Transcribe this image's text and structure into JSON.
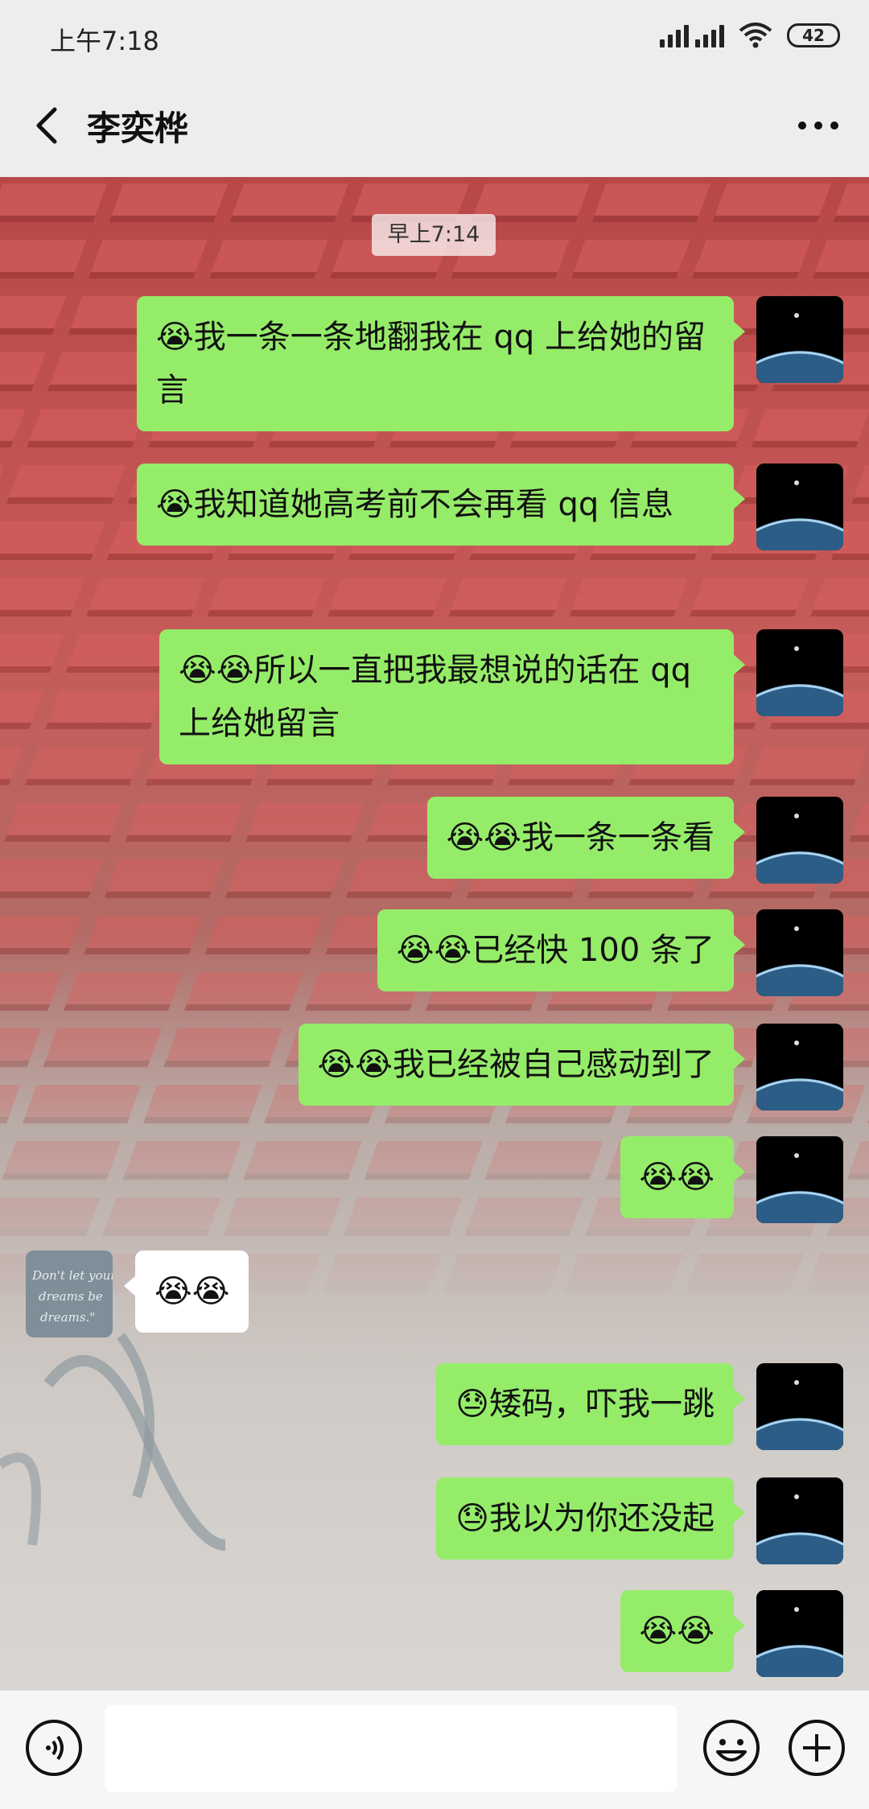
{
  "status_bar": {
    "time": "上午7:18",
    "battery": "42"
  },
  "header": {
    "contact_name": "李奕桦"
  },
  "chat": {
    "timestamp": "早上7:14",
    "messages": [
      {
        "sender": "me",
        "text": "😭我一条一条地翻我在 qq 上给她的留言"
      },
      {
        "sender": "me",
        "text": "😭我知道她高考前不会再看 qq 信息"
      },
      {
        "sender": "me",
        "text": "😭😭所以一直把我最想说的话在 qq 上给她留言"
      },
      {
        "sender": "me",
        "text": "😭😭我一条一条看"
      },
      {
        "sender": "me",
        "text": "😭😭已经快 100 条了"
      },
      {
        "sender": "me",
        "text": "😭😭我已经被自己感动到了"
      },
      {
        "sender": "me",
        "text": "😭😭"
      },
      {
        "sender": "other",
        "text": "😭😭"
      },
      {
        "sender": "me",
        "text": "😓矮码，吓我一跳"
      },
      {
        "sender": "me",
        "text": "😓我以为你还没起"
      },
      {
        "sender": "me",
        "text": "😭😭"
      }
    ],
    "other_avatar_text": "Don't let your dreams be dreams.\""
  },
  "input": {
    "value": ""
  },
  "icons": {
    "back": "back-arrow-icon",
    "more": "more-dots-icon",
    "voice": "voice-icon",
    "emoji": "emoji-icon",
    "plus": "plus-icon"
  },
  "colors": {
    "bubble_me": "#95ec69",
    "bubble_other": "#ffffff",
    "bar_bg": "#ededed"
  }
}
